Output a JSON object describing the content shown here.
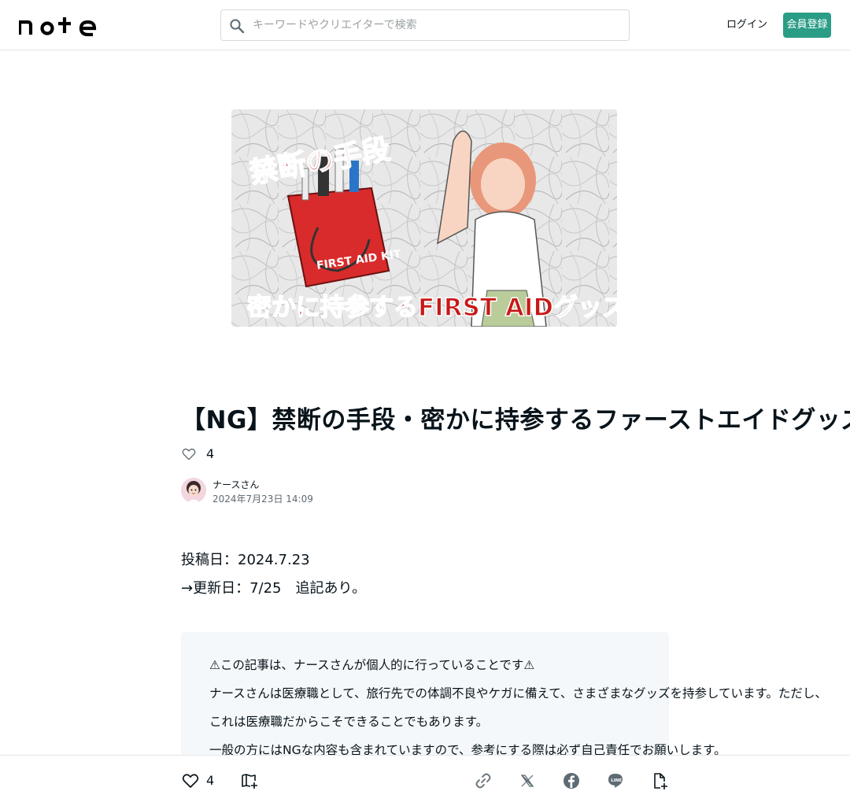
{
  "header": {
    "logo_text": "note",
    "search_placeholder": "キーワードやクリエイターで検索",
    "login_label": "ログイン",
    "signup_label": "会員登録"
  },
  "eyecatch": {
    "top_text": "禁断の手段",
    "bag_text": "FIRST AID KIT",
    "bottom_text": "密かに持参するFIRST AIDグッズ"
  },
  "article": {
    "title": "【NG】禁断の手段・密かに持参するファーストエイドグッズ",
    "like_count": "4",
    "author_name": "ナースさん",
    "date": "2024年7月23日 14:09",
    "body_lines": [
      "投稿日：2024.7.23",
      "→更新日：7/25　追記あり。"
    ],
    "notice_lines": [
      "⚠この記事は、ナースさんが個人的に行っていることです⚠",
      "ナースさんは医療職として、旅行先での体調不良やケガに備えて、さまざまなグッズを持参しています。ただし、",
      "これは医療職だからこそできることでもあります。",
      "一般の方にはNGな内容も含まれていますので、参考にする際は必ず自己責任でお願いします。"
    ]
  },
  "action_bar": {
    "like_count": "4",
    "icons": [
      "heart-icon",
      "magazine-add-icon",
      "link-icon",
      "x-icon",
      "facebook-icon",
      "line-icon",
      "embed-add-icon"
    ]
  },
  "colors": {
    "brand": "#2a9d86",
    "text": "#08131a",
    "muted": "#5e6b73",
    "notice_bg": "#f5f8fa"
  }
}
